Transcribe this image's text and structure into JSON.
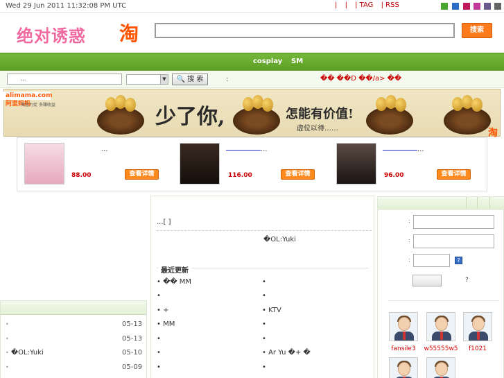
{
  "topbar": {
    "date": "Wed 29 Jun 2011 11:32:08 PM UTC",
    "links": [
      "|",
      "|",
      "| TAG",
      "| RSS"
    ],
    "swatches": [
      "#4aa72e",
      "#2b6cc4",
      "#c0185a",
      "#c03a9a",
      "#6a5a8a",
      "#666666"
    ]
  },
  "header": {
    "logo": "绝对诱惑",
    "tao_logo": "淘",
    "search_button": "搜索"
  },
  "nav": {
    "items": [
      "cosplay",
      "SM"
    ]
  },
  "searchrow": {
    "keyword_placeholder": "...",
    "search_button": "🔍 搜 索",
    "colon": ":",
    "red_links": "�� ��D ��/a>    ��"
  },
  "banner": {
    "alimama": "alimama.com阿里妈妈",
    "alimama_sub": "淘宝力促 多赚收益",
    "slogan_main": "少了你,",
    "slogan_right": "怎能有价值!",
    "slogan_sub": "虚位以待……",
    "tao": "淘"
  },
  "products": [
    {
      "title": "...",
      "price": "88.00",
      "button": "查看详情"
    },
    {
      "title": "...",
      "price": "116.00",
      "button": "查看详情"
    },
    {
      "title": "...",
      "price": "96.00",
      "button": "查看详情"
    }
  ],
  "center": {
    "row1": "...[  ]",
    "row2": "�OL:Yuki",
    "latest_heading": "最近更新",
    "left_items": [
      "�� MM",
      "",
      "   +",
      "  MM",
      "",
      "",
      ""
    ],
    "right_items": [
      "",
      "",
      "KTV",
      "",
      "",
      "Ar Yu �+ �",
      ""
    ]
  },
  "right": {
    "colons": [
      ":",
      ":",
      ":"
    ],
    "captcha_icon": "?",
    "question": "?",
    "users": [
      "fansile3",
      "w55555w5",
      "f1021",
      "",
      ""
    ]
  },
  "left": {
    "items": [
      {
        "text": "",
        "date": "05-13"
      },
      {
        "text": "",
        "date": "05-13"
      },
      {
        "text": "�OL:Yuki",
        "date": "05-10"
      },
      {
        "text": "",
        "date": "05-09"
      }
    ]
  }
}
